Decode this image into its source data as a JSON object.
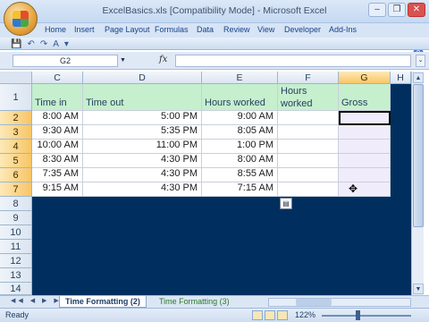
{
  "window": {
    "title": "ExcelBasics.xls  [Compatibility Mode]  -  Microsoft Excel",
    "minimize": "–",
    "restore": "❐",
    "close": "✕"
  },
  "ribbon": {
    "tabs": [
      "Home",
      "Insert",
      "Page Layout",
      "Formulas",
      "Data",
      "Review",
      "View",
      "Developer",
      "Add-Ins"
    ],
    "help": "?"
  },
  "formula_bar": {
    "name_box": "G2",
    "fx": "fx",
    "formula": ""
  },
  "grid": {
    "columns": [
      "C",
      "D",
      "E",
      "F",
      "G",
      "H"
    ],
    "rows": [
      "1",
      "2",
      "3",
      "4",
      "5",
      "6",
      "7",
      "8",
      "9",
      "10",
      "11",
      "12",
      "13",
      "14"
    ],
    "headers": {
      "c": "Time in",
      "d": "Time out",
      "e": "Hours worked",
      "f1": "Hours",
      "f2": "worked",
      "g": "Gross"
    },
    "data": [
      {
        "c": "8:00 AM",
        "d": "5:00 PM",
        "e": "9:00 AM"
      },
      {
        "c": "9:30 AM",
        "d": "5:35 PM",
        "e": "8:05 AM"
      },
      {
        "c": "10:00 AM",
        "d": "11:00 PM",
        "e": "1:00 PM"
      },
      {
        "c": "8:30 AM",
        "d": "4:30 PM",
        "e": "8:00 AM"
      },
      {
        "c": "7:35 AM",
        "d": "4:30 PM",
        "e": "8:55 AM"
      },
      {
        "c": "9:15 AM",
        "d": "4:30 PM",
        "e": "7:15 AM"
      }
    ]
  },
  "sheets": {
    "nav": "◀◀ ◀ ▶ ▶▶",
    "active": "Time Formatting (2)",
    "other": "Time Formatting (3)"
  },
  "status": {
    "text": "Ready",
    "zoom": "122%"
  },
  "colors": {
    "header_fill": "#c6efce",
    "gross_fill": "#f1ecfb",
    "background": "#002f5f"
  }
}
